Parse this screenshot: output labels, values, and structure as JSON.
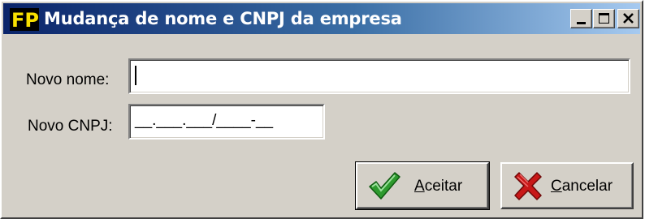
{
  "window": {
    "title": "Mudança de nome e CNPJ da empresa",
    "app_logo_text": "FP",
    "controls": [
      "minimize",
      "maximize",
      "close"
    ]
  },
  "form": {
    "nome_label": "Novo nome:",
    "nome_value": "",
    "cnpj_label": "Novo CNPJ:",
    "cnpj_mask": "__.___.___/____-__"
  },
  "buttons": {
    "accept": {
      "accel": "A",
      "rest": "ceitar"
    },
    "cancel": {
      "accel": "C",
      "rest": "ancelar"
    }
  },
  "colors": {
    "titlebar_start": "#0a246a",
    "titlebar_end": "#a6caf0",
    "dialog_face": "#d4d0c8",
    "logo_yellow": "#f8e000",
    "check_green": "#2e9a2e",
    "x_red": "#c81818"
  },
  "icons": {
    "accept": "checkmark-icon",
    "cancel": "red-x-icon"
  }
}
